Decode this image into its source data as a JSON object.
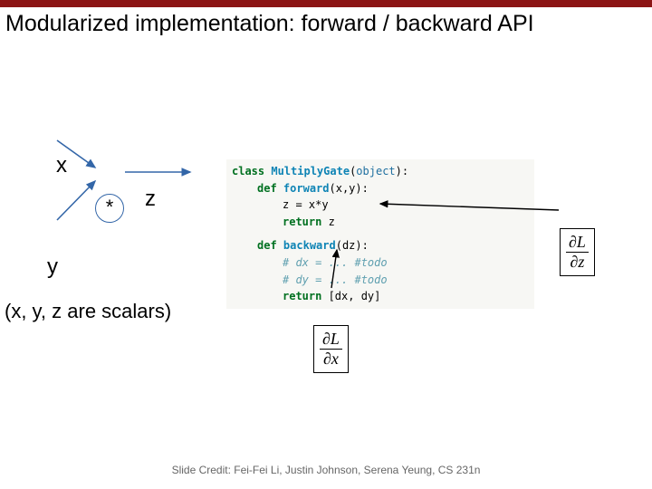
{
  "title": "Modularized implementation: forward / backward API",
  "graph": {
    "x": "x",
    "y": "y",
    "z": "z",
    "op": "*",
    "caption": "(x, y, z are scalars)"
  },
  "code": {
    "l1_kw": "class",
    "l1_name": "MultiplyGate",
    "l1_arg": "object",
    "l2_kw": "def",
    "l2_name": "forward",
    "l2_args": "(x,y)",
    "l3": "z = x*y",
    "l4_kw": "return",
    "l4_v": " z",
    "l5_kw": "def",
    "l5_name": "backward",
    "l5_args": "(dz)",
    "l6_c": "# dx = ... #todo",
    "l7_c": "# dy = ... #todo",
    "l8_kw": "return",
    "l8_v": " [dx, dy]"
  },
  "math": {
    "dz_num": "∂L",
    "dz_den": "∂z",
    "dx_num": "∂L",
    "dx_den": "∂x"
  },
  "footer": "Slide Credit: Fei-Fei Li, Justin Johnson, Serena Yeung, CS 231n"
}
